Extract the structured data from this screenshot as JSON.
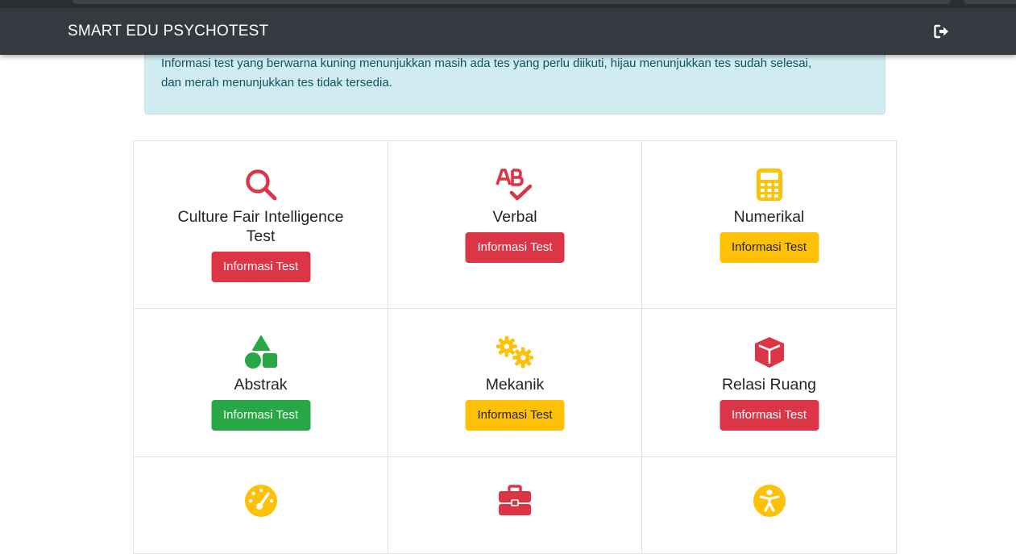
{
  "navbar": {
    "brand": "SMART EDU PSYCHOTEST",
    "logout_icon": "sign-out-icon"
  },
  "alert": {
    "text_line1": "Informasi test yang berwarna kuning menunjukkan masih ada tes yang perlu diikuti, hijau menunjukkan tes sudah selesai,",
    "text_line2": "dan merah menunjukkan tes tidak tersedia."
  },
  "colors": {
    "red": "#dc3545",
    "yellow": "#ffc107",
    "green": "#28a745",
    "navbar": "#343a40",
    "alert_bg": "#d1ecf1"
  },
  "tests": [
    {
      "title": "Culture Fair Intelligence Test",
      "button": "Informasi Test",
      "status": "red",
      "icon": "search-icon"
    },
    {
      "title": "Verbal",
      "button": "Informasi Test",
      "status": "red",
      "icon": "spell-check-icon"
    },
    {
      "title": "Numerikal",
      "button": "Informasi Test",
      "status": "yellow",
      "icon": "calculator-icon"
    },
    {
      "title": "Abstrak",
      "button": "Informasi Test",
      "status": "green",
      "icon": "shapes-icon"
    },
    {
      "title": "Mekanik",
      "button": "Informasi Test",
      "status": "yellow",
      "icon": "cogs-icon"
    },
    {
      "title": "Relasi Ruang",
      "button": "Informasi Test",
      "status": "red",
      "icon": "cube-icon"
    },
    {
      "title": "",
      "button": "",
      "status": "yellow",
      "icon": "tachometer-icon"
    },
    {
      "title": "",
      "button": "",
      "status": "red",
      "icon": "briefcase-icon"
    },
    {
      "title": "",
      "button": "",
      "status": "yellow",
      "icon": "accessibility-icon"
    }
  ]
}
